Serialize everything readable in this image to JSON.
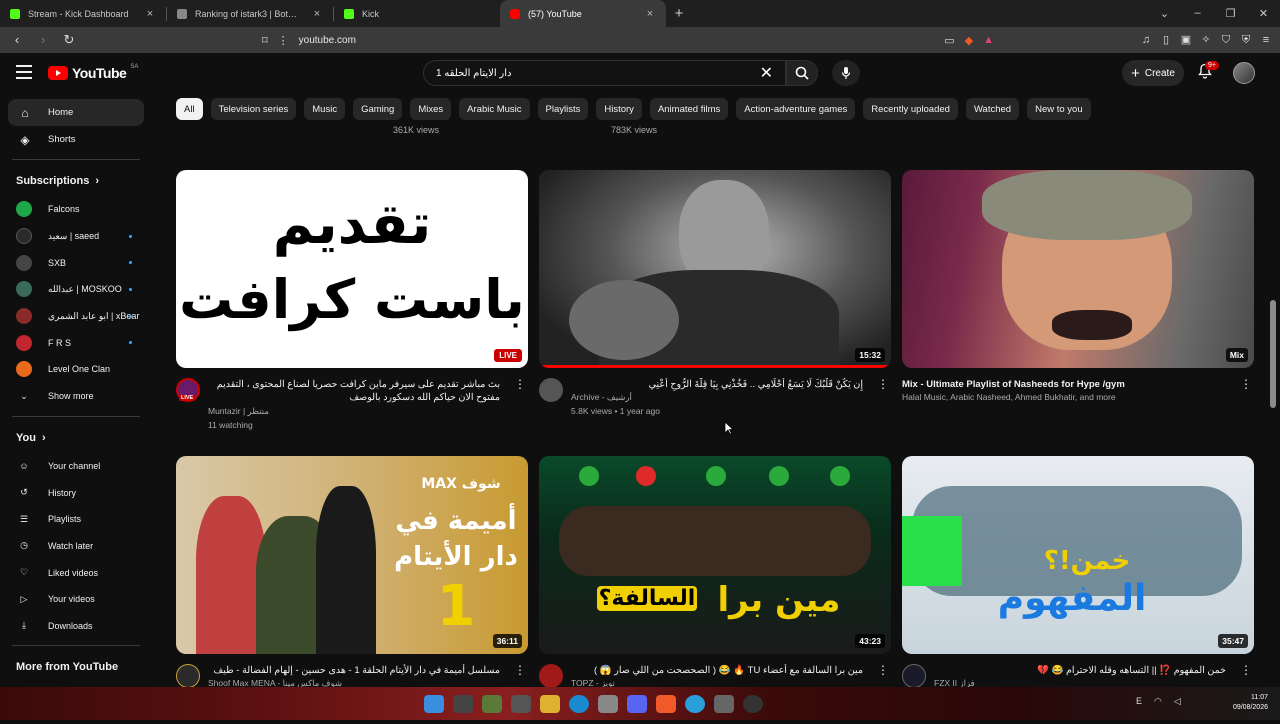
{
  "browser": {
    "tabs": [
      {
        "label": "Stream - Kick Dashboard",
        "color": "#53fc18"
      },
      {
        "label": "Ranking of istark3 | BotRix — Cloud",
        "color": "#888888"
      },
      {
        "label": "Kick",
        "color": "#53fc18"
      },
      {
        "label": "(57) YouTube",
        "color": "#ff0000",
        "active": true
      }
    ],
    "url": "youtube.com"
  },
  "header": {
    "logo_text": "YouTube",
    "country_code": "SA",
    "search_query": "دار الايتام الحلقه 1",
    "create_label": "Create",
    "notification_count": "9+"
  },
  "sidebar": {
    "main": [
      {
        "label": "Home",
        "icon": "home-icon"
      },
      {
        "label": "Shorts",
        "icon": "shorts-icon"
      }
    ],
    "subscriptions_title": "Subscriptions",
    "subscriptions": [
      {
        "label": "Falcons",
        "color": "#1ea84a",
        "dot": false
      },
      {
        "label": "سعيد | saeed",
        "color": "#2a2a2a",
        "dot": true
      },
      {
        "label": "SXB",
        "color": "#444444",
        "dot": true
      },
      {
        "label": "عبدالله | MOSKOO",
        "color": "#3a6a5a",
        "dot": true
      },
      {
        "label": "ابو عابد الشمري | xBear",
        "color": "#8a2a2a",
        "dot": true
      },
      {
        "label": "F R S",
        "color": "#c0262d",
        "dot": true
      },
      {
        "label": "Level One Clan",
        "color": "#e86a1a",
        "dot": false
      }
    ],
    "show_more": "Show more",
    "you_title": "You",
    "you_items": [
      {
        "label": "Your channel",
        "icon": "channel-icon"
      },
      {
        "label": "History",
        "icon": "history-icon"
      },
      {
        "label": "Playlists",
        "icon": "playlists-icon"
      },
      {
        "label": "Watch later",
        "icon": "watch-later-icon"
      },
      {
        "label": "Liked videos",
        "icon": "liked-icon"
      },
      {
        "label": "Your videos",
        "icon": "your-videos-icon"
      },
      {
        "label": "Downloads",
        "icon": "downloads-icon"
      }
    ],
    "more_title": "More from YouTube"
  },
  "chips": [
    "All",
    "Television series",
    "Music",
    "Gaming",
    "Mixes",
    "Arabic Music",
    "Playlists",
    "History",
    "Animated films",
    "Action-adventure games",
    "Recently uploaded",
    "Watched",
    "New to you"
  ],
  "prev_row_views": [
    "361K views",
    "783K views"
  ],
  "videos": [
    {
      "title": "بث مباشر تقديم على سيرفر ماين كرافت حصريا لصناع المحتوى ، التقديم مفتوح الان حياكم الله دسكورد بالوصف",
      "channel": "Muntazir | منتظر",
      "stats": "11 watching",
      "badge": "LIVE",
      "thumb_text": [
        "تقديم",
        "باست كرافت"
      ],
      "avatar_color": "#6a1a6a"
    },
    {
      "title": "إِن يَكُنْ قَلْبُكَ لَا يَسَعُ أَحْلَامِي .. فَخُذْنِي بِيَا قِلَّةَ الرُّوحِ أَعْنِي",
      "channel": "Archive - أرشيف",
      "stats": "5.8K views • 1 year ago",
      "badge": "15:32",
      "progress": 1.0,
      "avatar_color": "#555555"
    },
    {
      "title": "Mix - Ultimate Playlist of Nasheeds for Hype /gym",
      "channel": "Halal Music, Arabic Nasheed, Ahmed Bukhatir, and more",
      "stats": "",
      "badge": "Mix"
    },
    {
      "title": "مسلسل أميمة في دار الأيتام الحلقة 1 - هدى حسين - إلهام الفضالة - طيف",
      "channel": "Shoof Max MENA - شوف ماكس مينا",
      "stats": "",
      "badge": "36:11",
      "thumb_text": [
        "أميمة في",
        "دار الأيتام",
        "1"
      ],
      "thumb_brand": "شوف MAX",
      "avatar_color": "#2a2a2a"
    },
    {
      "title": "مين برا السالفة مع أعضاء TU 🔥 😂 ( الصحصحت من اللي صار 😱 )",
      "channel": "TOPZ - توبز",
      "stats": "",
      "badge": "43:23",
      "thumb_text": [
        "مين برا",
        "السالفة؟"
      ],
      "avatar_color": "#a01a1a"
    },
    {
      "title": "خمن المفهوم ⁉️ || التساهه وقله الاحترام 😂 💔",
      "channel": "FZX II فزاز",
      "stats": "",
      "badge": "35:47",
      "thumb_text": [
        "خمن!؟",
        "المفهوم"
      ],
      "avatar_color": "#1a1a2a"
    }
  ],
  "taskbar": {
    "time": "11:07",
    "date": "09/08/2026",
    "lang": "E"
  }
}
